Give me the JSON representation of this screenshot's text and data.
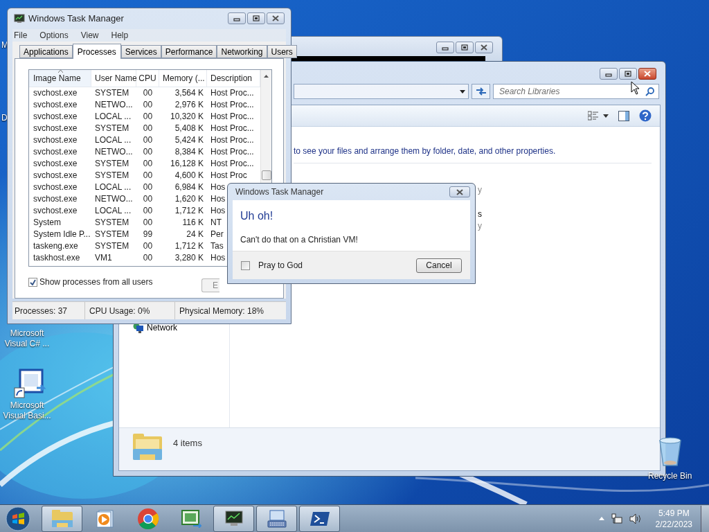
{
  "desktop": {
    "icons": [
      {
        "kind": "cut",
        "label": "M"
      },
      {
        "kind": "cut",
        "label": "D"
      },
      {
        "kind": "hidden",
        "label": "Microsoft Visual C# ..."
      },
      {
        "kind": "vb",
        "label": "Microsoft Visual Basi..."
      },
      {
        "kind": "recycle",
        "label": "Recycle Bin"
      }
    ]
  },
  "explorer": {
    "search": {
      "placeholder": "Search Libraries"
    },
    "hint": "to see your files and arrange them by folder, date, and other properties.",
    "fragments": [
      {
        "text": "y",
        "dim": true
      },
      {
        "text": "s",
        "dim": false
      },
      {
        "text": "y",
        "dim": true
      }
    ],
    "nav_items": [
      {
        "label": "Network"
      }
    ],
    "details": "4 items"
  },
  "task_manager": {
    "title": "Windows Task Manager",
    "menu": [
      "File",
      "Options",
      "View",
      "Help"
    ],
    "tabs": [
      {
        "label": "Applications",
        "selected": false
      },
      {
        "label": "Processes",
        "selected": true
      },
      {
        "label": "Services",
        "selected": false
      },
      {
        "label": "Performance",
        "selected": false
      },
      {
        "label": "Networking",
        "selected": false
      },
      {
        "label": "Users",
        "selected": false
      }
    ],
    "columns": [
      {
        "label": "Image Name",
        "sorted": true
      },
      {
        "label": "User Name",
        "sorted": false
      },
      {
        "label": "CPU",
        "sorted": false
      },
      {
        "label": "Memory (...",
        "sorted": false
      },
      {
        "label": "Description",
        "sorted": false
      }
    ],
    "rows": [
      [
        "svchost.exe",
        "SYSTEM",
        "00",
        "3,564 K",
        "Host Proc..."
      ],
      [
        "svchost.exe",
        "NETWO...",
        "00",
        "2,976 K",
        "Host Proc..."
      ],
      [
        "svchost.exe",
        "LOCAL ...",
        "00",
        "10,320 K",
        "Host Proc..."
      ],
      [
        "svchost.exe",
        "SYSTEM",
        "00",
        "5,408 K",
        "Host Proc..."
      ],
      [
        "svchost.exe",
        "LOCAL ...",
        "00",
        "5,424 K",
        "Host Proc..."
      ],
      [
        "svchost.exe",
        "NETWO...",
        "00",
        "8,384 K",
        "Host Proc..."
      ],
      [
        "svchost.exe",
        "SYSTEM",
        "00",
        "16,128 K",
        "Host Proc..."
      ],
      [
        "svchost.exe",
        "SYSTEM",
        "00",
        "4,600 K",
        "Host Proc"
      ],
      [
        "svchost.exe",
        "LOCAL ...",
        "00",
        "6,984 K",
        "Hos"
      ],
      [
        "svchost.exe",
        "NETWO...",
        "00",
        "1,620 K",
        "Hos"
      ],
      [
        "svchost.exe",
        "LOCAL ...",
        "00",
        "1,712 K",
        "Hos"
      ],
      [
        "System",
        "SYSTEM",
        "00",
        "116 K",
        "NT"
      ],
      [
        "System Idle P...",
        "SYSTEM",
        "99",
        "24 K",
        "Per"
      ],
      [
        "taskeng.exe",
        "SYSTEM",
        "00",
        "1,712 K",
        "Tas"
      ],
      [
        "taskhost.exe",
        "VM1",
        "00",
        "3,280 K",
        "Hos"
      ]
    ],
    "show_all": {
      "label": "Show processes from all users",
      "checked": true
    },
    "end_button": "E",
    "status": [
      "Processes: 37",
      "CPU Usage: 0%",
      "Physical Memory: 18%"
    ]
  },
  "dialog": {
    "title": "Windows Task Manager",
    "heading": "Uh oh!",
    "message": "Can't do that on a Christian VM!",
    "checkbox": {
      "label": "Pray to God",
      "checked": false
    },
    "button": "Cancel"
  },
  "taskbar": {
    "apps": [
      {
        "kind": "explorer",
        "running": true
      },
      {
        "kind": "media",
        "running": false
      },
      {
        "kind": "browser",
        "running": false
      },
      {
        "kind": "csharp",
        "running": false
      },
      {
        "kind": "taskmgr",
        "running": true
      },
      {
        "kind": "keyboard",
        "running": true
      },
      {
        "kind": "powershell",
        "running": true
      }
    ],
    "clock": {
      "time": "5:49 PM",
      "date": "2/22/2023"
    }
  }
}
